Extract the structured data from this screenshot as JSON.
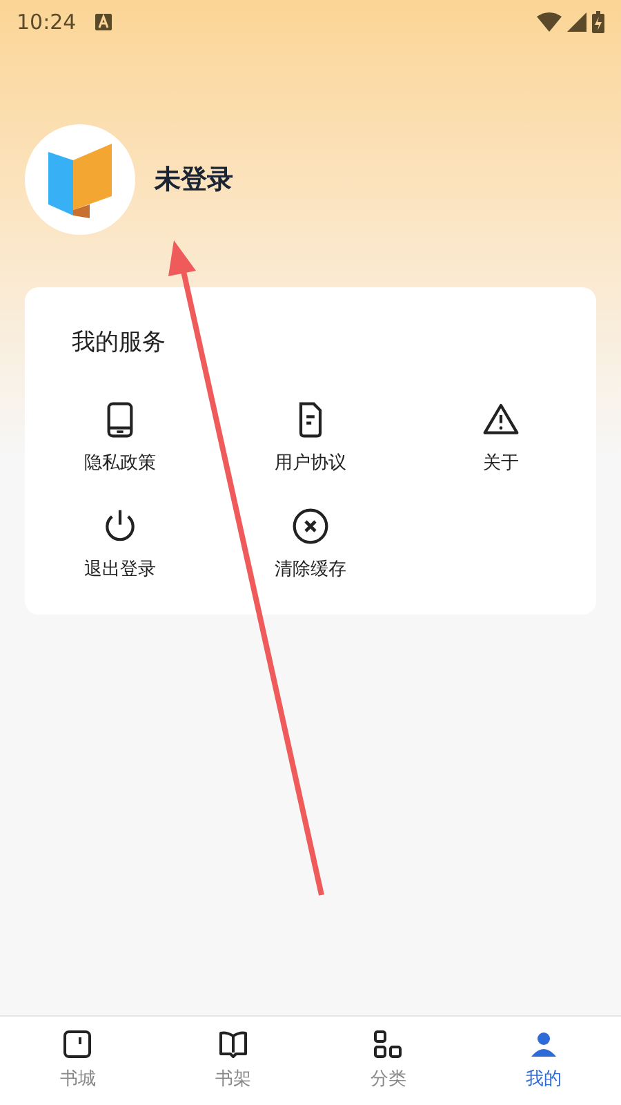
{
  "status_bar": {
    "time": "10:24"
  },
  "profile": {
    "name": "未登录"
  },
  "services": {
    "title": "我的服务",
    "items": [
      {
        "label": "隐私政策",
        "kind": "phone"
      },
      {
        "label": "用户协议",
        "kind": "document"
      },
      {
        "label": "关于",
        "kind": "warning"
      },
      {
        "label": "退出登录",
        "kind": "power"
      },
      {
        "label": "清除缓存",
        "kind": "clear"
      }
    ]
  },
  "tabs": [
    {
      "label": "书城",
      "kind": "store",
      "selected": false
    },
    {
      "label": "书架",
      "kind": "shelf",
      "selected": false
    },
    {
      "label": "分类",
      "kind": "category",
      "selected": false
    },
    {
      "label": "我的",
      "kind": "me",
      "selected": true
    }
  ]
}
